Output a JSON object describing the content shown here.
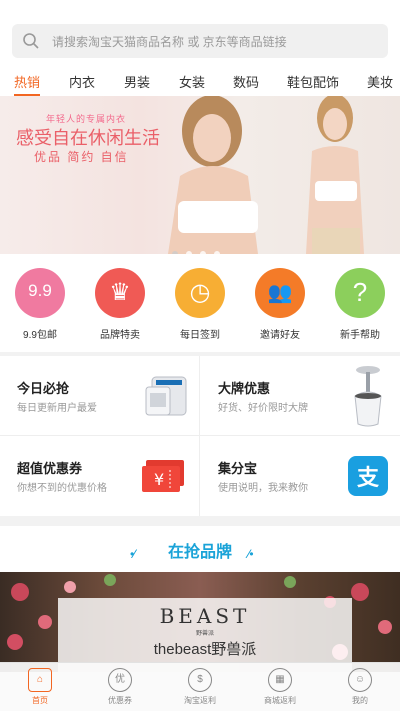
{
  "search": {
    "placeholder": "请搜索淘宝天猫商品名称 或 京东等商品链接"
  },
  "tabs": [
    "热销",
    "内衣",
    "男装",
    "女装",
    "数码",
    "鞋包配饰",
    "美妆"
  ],
  "banner": {
    "tagline": "年轻人的专属内衣",
    "headline": "感受自在休闲生活",
    "subline": "优品 简约 自信",
    "slide_count": 4,
    "active_slide": 1
  },
  "quick_links": [
    {
      "label": "9.9包邮",
      "glyph": "9.9",
      "icon": "price-tag-icon",
      "color": "#f07aa0"
    },
    {
      "label": "品牌特卖",
      "glyph": "♛",
      "icon": "crown-icon",
      "color": "#f05a55"
    },
    {
      "label": "每日签到",
      "glyph": "◷",
      "icon": "clock-icon",
      "color": "#f7ae34"
    },
    {
      "label": "邀请好友",
      "glyph": "👥",
      "icon": "people-icon",
      "color": "#f47b28"
    },
    {
      "label": "新手帮助",
      "glyph": "?",
      "icon": "question-icon",
      "color": "#8ccf5c"
    }
  ],
  "promos": [
    {
      "title": "今日必抢",
      "subtitle": "每日更新用户最爱",
      "icon": "air-purifier-icon"
    },
    {
      "title": "大牌优惠",
      "subtitle": "好货、好价限时大牌",
      "icon": "speaker-icon"
    },
    {
      "title": "超值优惠券",
      "subtitle": "你想不到的优惠价格",
      "icon": "coupon-icon"
    },
    {
      "title": "集分宝",
      "subtitle": "使用说明，我来教你",
      "icon": "alipay-icon"
    }
  ],
  "brand_section": {
    "title": "在抢品牌",
    "logo": "BEAST",
    "logo_sub": "野兽派",
    "name": "thebeast野兽派"
  },
  "tabbar": [
    {
      "label": "首页",
      "glyph": "⌂",
      "icon": "home-icon",
      "active": true
    },
    {
      "label": "优惠券",
      "glyph": "优",
      "icon": "coupon-tab-icon",
      "active": false
    },
    {
      "label": "淘宝返利",
      "glyph": "$",
      "icon": "rebate-icon",
      "active": false
    },
    {
      "label": "商城返利",
      "glyph": "▦",
      "icon": "mall-icon",
      "active": false
    },
    {
      "label": "我的",
      "glyph": "☺",
      "icon": "user-icon",
      "active": false
    }
  ],
  "colors": {
    "accent": "#f26622",
    "brand_blue": "#1aa3d8"
  }
}
